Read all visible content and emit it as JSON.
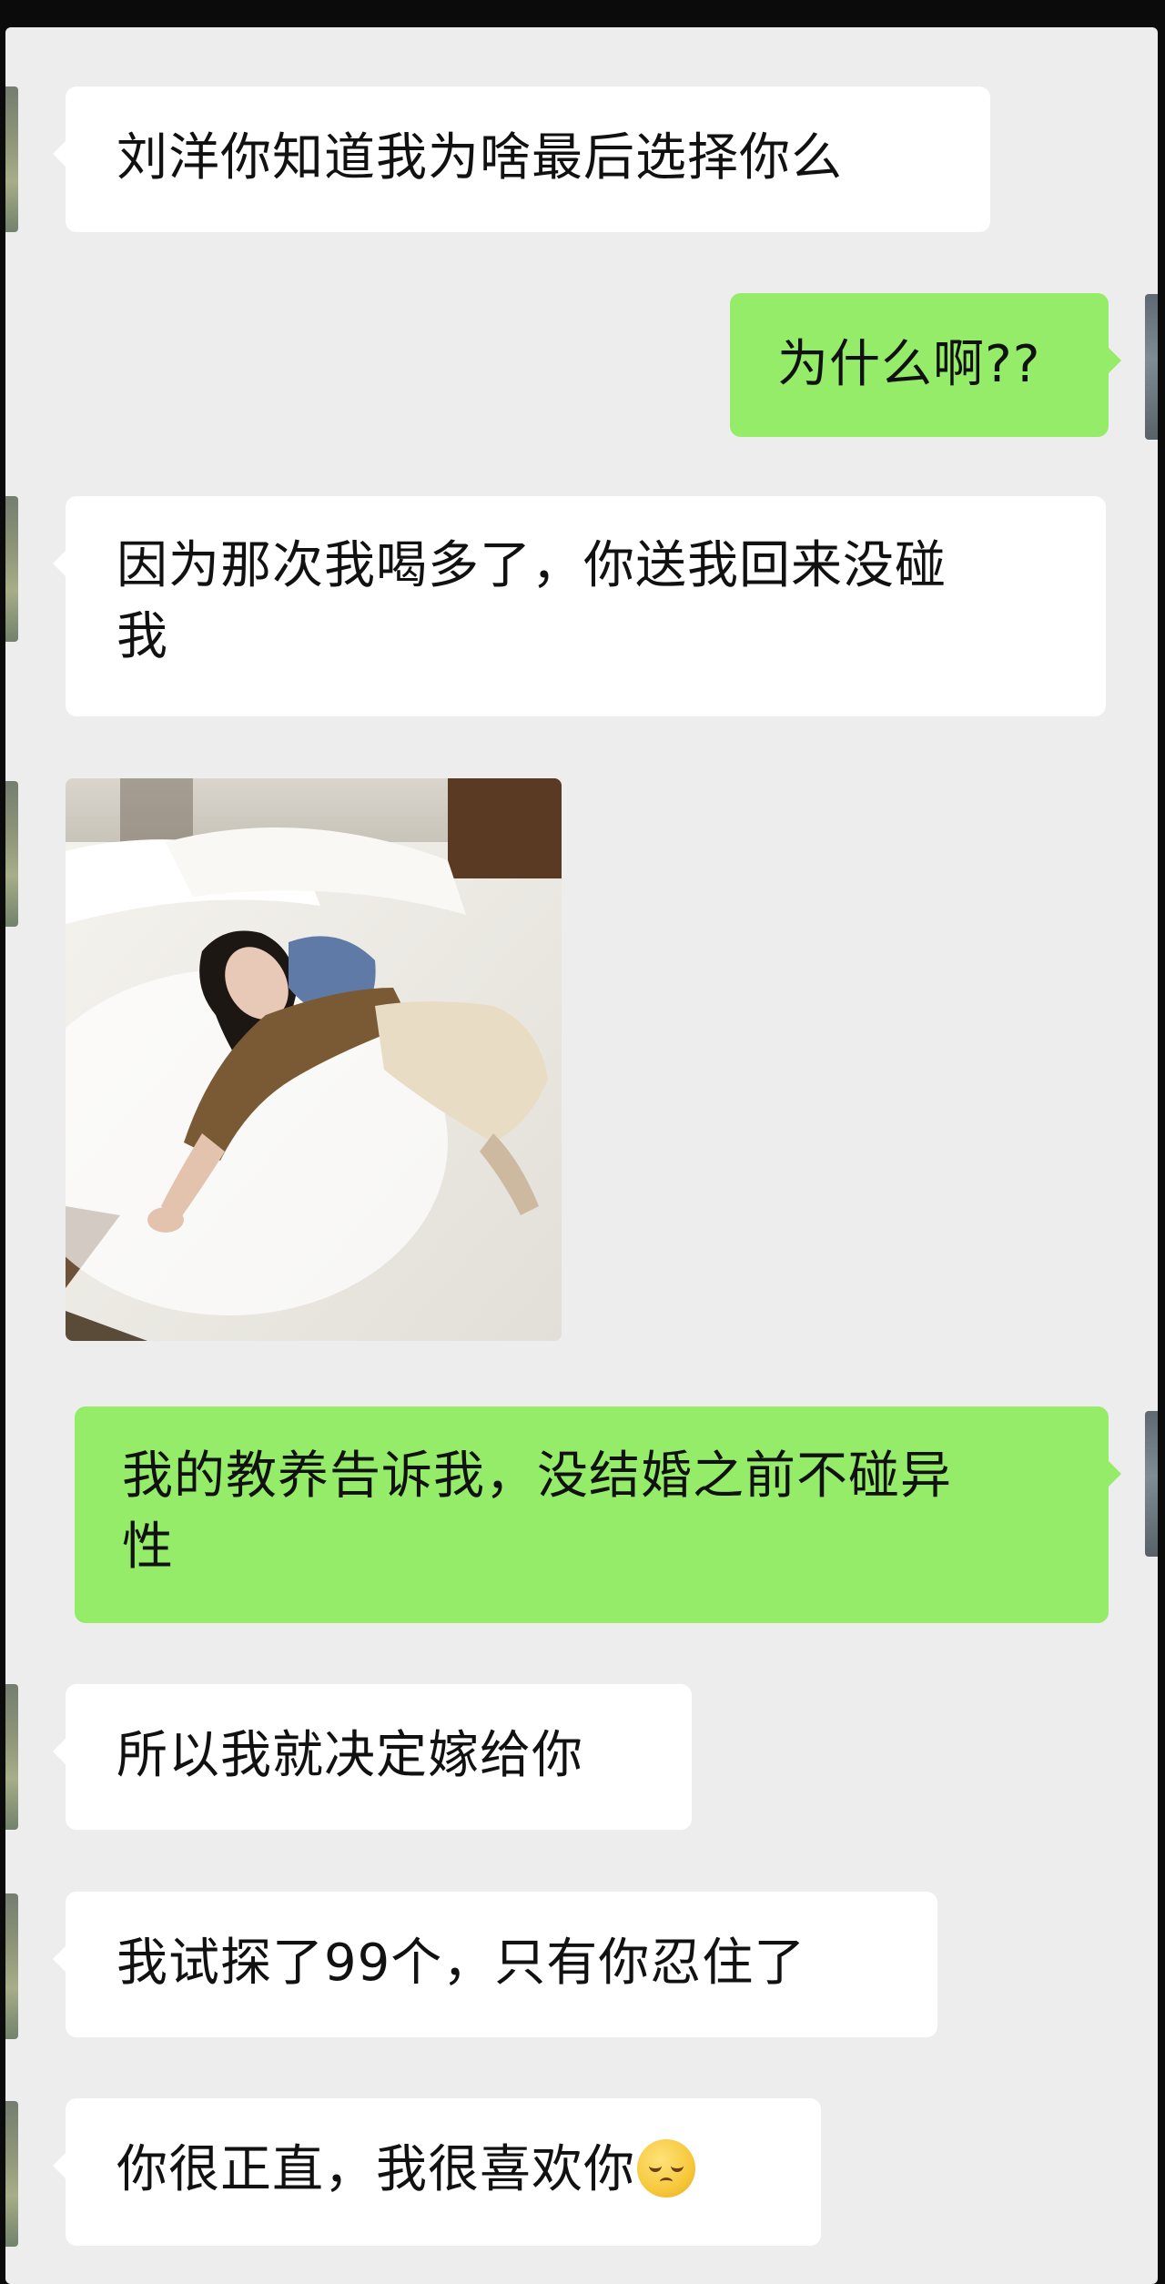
{
  "messages": [
    {
      "side": "left",
      "text": "刘洋你知道我为啥最后选择你么"
    },
    {
      "side": "right",
      "text": "为什么啊??"
    },
    {
      "side": "left",
      "line1": "因为那次我喝多了，你送我回来没碰",
      "line2": "我"
    },
    {
      "side": "left",
      "type": "image",
      "image": "photo-woman-lying-on-bed"
    },
    {
      "side": "right",
      "line1": "我的教养告诉我，没结婚之前不碰异",
      "line2": "性"
    },
    {
      "side": "left",
      "text": "所以我就决定嫁给你"
    },
    {
      "side": "left",
      "text": "我试探了99个，只有你忍住了"
    },
    {
      "side": "left",
      "text": "你很正直，我很喜欢你",
      "emoji": "relieved-face-emoji"
    }
  ],
  "colors": {
    "background": "#ededed",
    "bubble_left": "#ffffff",
    "bubble_right": "#95ec69"
  }
}
